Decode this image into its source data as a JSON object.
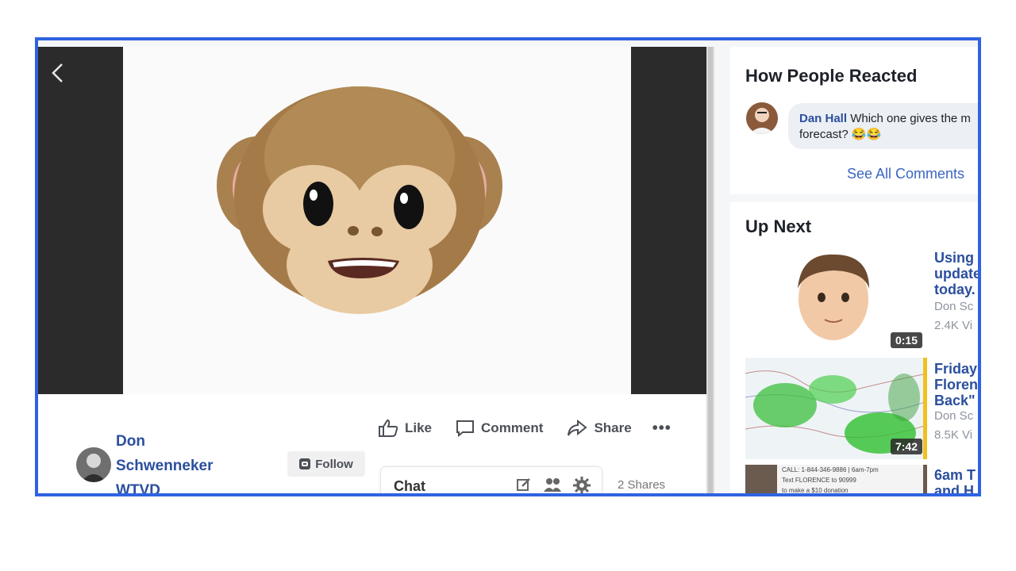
{
  "video": {
    "back_icon": "chevron-left-icon",
    "content": "monkey-emoji-face"
  },
  "post": {
    "author_lines": [
      "Don",
      "Schwenneker",
      "WTVD"
    ],
    "follow_label": "Follow",
    "actions": {
      "like": "Like",
      "comment": "Comment",
      "share": "Share",
      "more": "•••"
    },
    "shares_text": "2 Shares"
  },
  "chat": {
    "label": "Chat",
    "icons": [
      "compose-icon",
      "people-icon",
      "gear-icon"
    ]
  },
  "reactions": {
    "title": "How People Reacted",
    "comment": {
      "author": "Dan Hall",
      "text_line1": "Which one gives the m",
      "text_line2": "forecast? 😂😂"
    },
    "see_all": "See All Comments"
  },
  "up_next": {
    "title": "Up Next",
    "items": [
      {
        "title_lines": "Using\nupdate\ntoday.",
        "meta_lines": "Don Sc\n2.4K Vi",
        "duration": "0:15"
      },
      {
        "title_lines": "Friday\nFloren\nBack\"",
        "meta_lines": "Don Sc\n8.5K Vi",
        "duration": "7:42"
      },
      {
        "title_lines": "6am T\nand H",
        "meta_lines": "",
        "duration": ""
      }
    ],
    "thumb3_lines": [
      "CALL: 1-844-346-9886 | 6am-7pm",
      "Text FLORENCE to 90999",
      "to make a $10 donation"
    ]
  },
  "colors": {
    "frame_border": "#2f63e0",
    "link_blue": "#2b4f9e"
  }
}
